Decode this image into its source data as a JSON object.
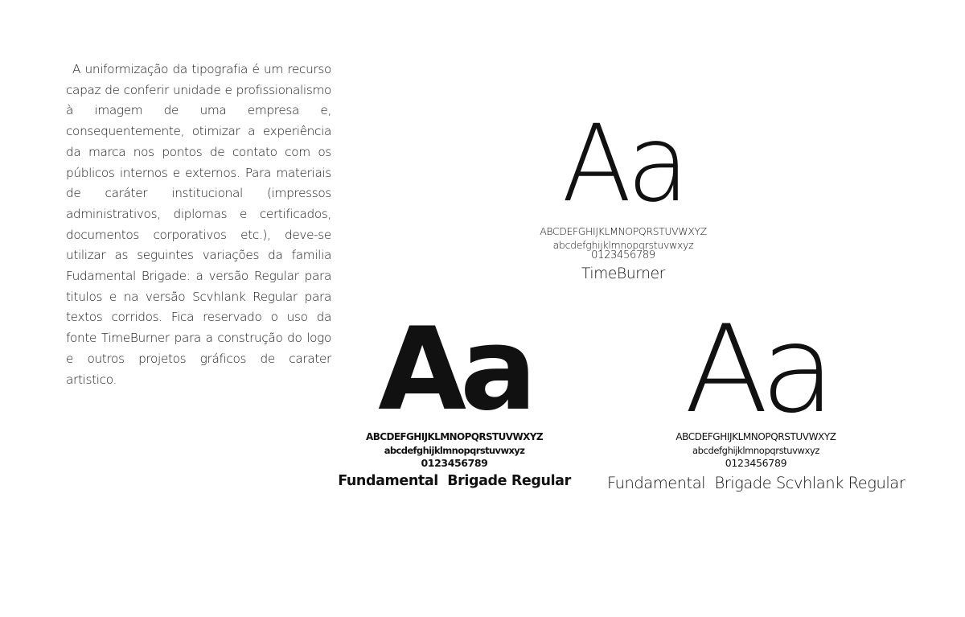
{
  "intro": {
    "paragraph": "A uniformização da tipografia é um re­curso capaz de conferir unidade e profis­sionalismo à imagem de uma empresa e, consequentemente, otimizar a experiên­cia da marca nos pontos de contato com os públicos internos e externos. Para ma­teriais de caráter institucional (impressos administrativos, diplomas e certificados, documentos corporativos etc.), deve-se utilizar as seguintes variações da familia Fudamental Brigade: a versão Regular para titulos e na versão Scvhlank Regu­lar para textos corridos. Fica reservado o uso da fonte TimeBurner para a constru­ção do logo e outros projetos gráficos de carater artistico."
  },
  "specimens": {
    "timeburner": {
      "glyph": "Aa",
      "uppercase": "ABCDEFGHIJKLMNOPQRSTUVWXYZ",
      "lowercase": "abcdefghijklmnopqrstuvwxyz",
      "digits": "0123456789",
      "name": "TimeBurner"
    },
    "fb_regular": {
      "glyph": "Aa",
      "uppercase": "ABCDEFGHIJKLMNOPQRSTUVWXYZ",
      "lowercase": "abcdefghijklmnopqrstuvwxyz",
      "digits": "0123456789",
      "name": "Fundamental  Brigade Regular"
    },
    "fb_scvhlank": {
      "glyph": "Aa",
      "uppercase": "ABCDEFGHIJKLMNOPQRSTUVWXYZ",
      "lowercase": "abcdefghijklmnopqrstuvwxyz",
      "digits": "0123456789",
      "name": "Fundamental  Brigade Scvhlank Regular"
    }
  },
  "colors": {
    "text": "#111111",
    "background": "#ffffff"
  }
}
